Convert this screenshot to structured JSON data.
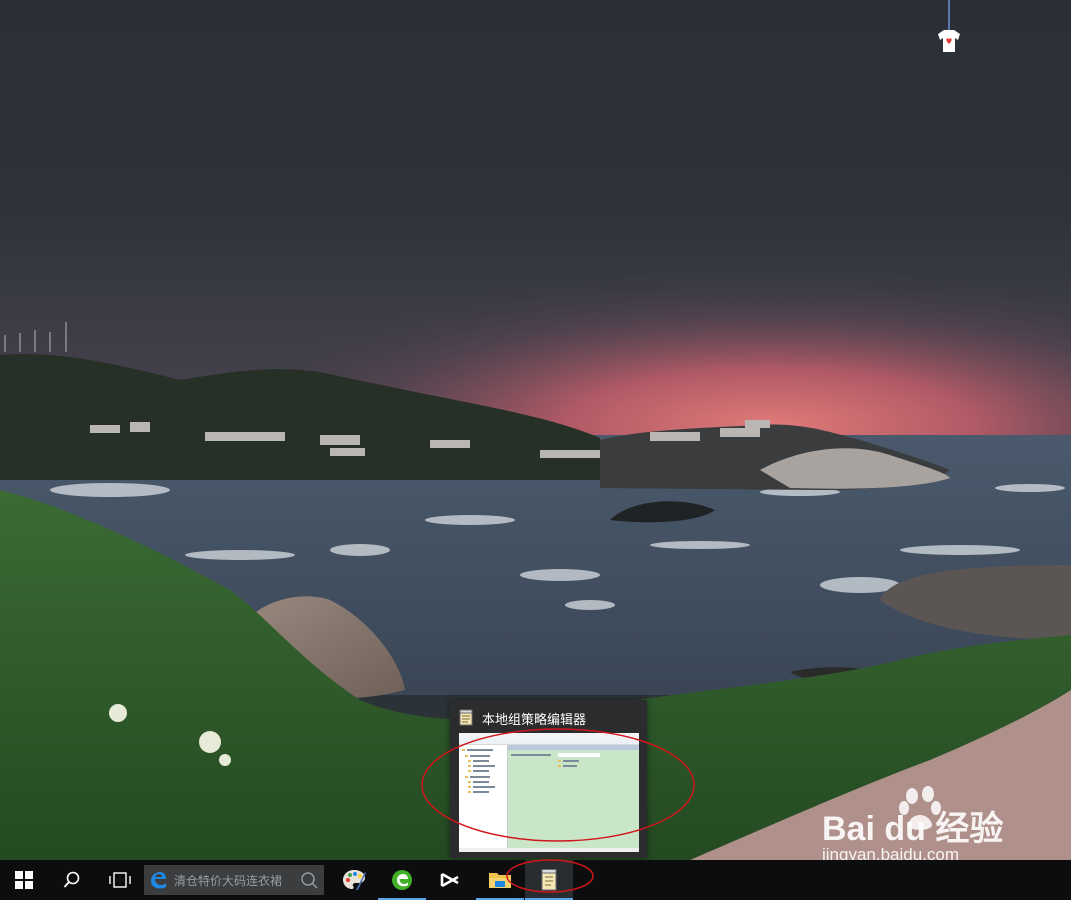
{
  "taskbar": {
    "search_placeholder": "清仓特价大码连衣裙",
    "pinned": [
      {
        "name": "paint-app",
        "icon": "palette-icon"
      },
      {
        "name": "green-app",
        "icon": "green-circle-icon"
      },
      {
        "name": "capcut-app",
        "icon": "capcut-icon"
      },
      {
        "name": "file-explorer",
        "icon": "folder-icon"
      },
      {
        "name": "gpedit",
        "icon": "policy-editor-icon"
      }
    ]
  },
  "thumbnail": {
    "title": "本地组策略编辑器"
  },
  "watermark": {
    "brand": "Bai du 经验",
    "url": "jingyan.baidu.com"
  },
  "colors": {
    "taskbar_bg": "#0c0d0f",
    "active_indicator": "#5aa5e6",
    "annotation": "#d0161b"
  }
}
